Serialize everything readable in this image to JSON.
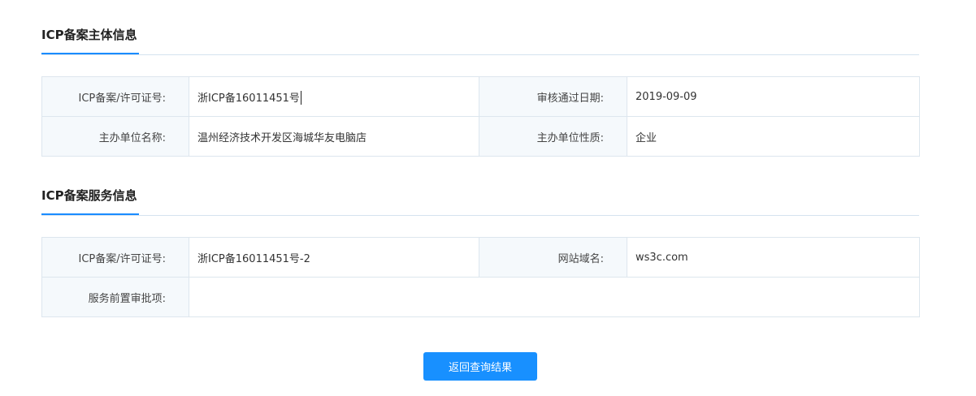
{
  "subject_section": {
    "title": "ICP备案主体信息",
    "rows": [
      {
        "label_left": "ICP备案/许可证号:",
        "value_left": "浙ICP备16011451号",
        "label_right": "审核通过日期:",
        "value_right": "2019-09-09"
      },
      {
        "label_left": "主办单位名称:",
        "value_left": "温州经济技术开发区海城华友电脑店",
        "label_right": "主办单位性质:",
        "value_right": "企业"
      }
    ]
  },
  "service_section": {
    "title": "ICP备案服务信息",
    "row1": {
      "label_left": "ICP备案/许可证号:",
      "value_left": "浙ICP备16011451号-2",
      "label_right": "网站域名:",
      "value_right": "ws3c.com"
    },
    "row2": {
      "label": "服务前置审批项:",
      "value": ""
    }
  },
  "back_button": {
    "label": "返回查询结果"
  },
  "colors": {
    "accent": "#1890ff",
    "label_bg": "#f5f9fc",
    "border": "#dde6ee"
  }
}
